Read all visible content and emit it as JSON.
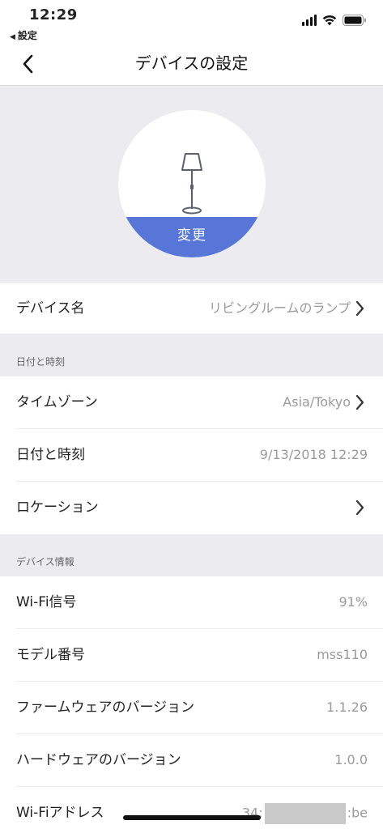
{
  "status_bar": {
    "time": "12:29",
    "back_app": "設定"
  },
  "nav": {
    "title": "デバイスの設定"
  },
  "device_image": {
    "change_label": "変更",
    "accent_color": "#5776d8"
  },
  "device_name_row": {
    "label": "デバイス名",
    "value": "リビングルームのランプ"
  },
  "datetime_section": {
    "header": "日付と時刻",
    "rows": [
      {
        "label": "タイムゾーン",
        "value": "Asia/Tokyo"
      },
      {
        "label": "日付と時刻",
        "value": "9/13/2018 12:29"
      },
      {
        "label": "ロケーション",
        "value": ""
      }
    ]
  },
  "device_info_section": {
    "header": "デバイス情報",
    "rows": [
      {
        "label": "Wi-Fi信号",
        "value": "91%"
      },
      {
        "label": "モデル番号",
        "value": "mss110"
      },
      {
        "label": "ファームウェアのバージョン",
        "value": "1.1.26"
      },
      {
        "label": "ハードウェアのバージョン",
        "value": "1.0.0"
      },
      {
        "label": "Wi-Fiアドレス",
        "value_prefix": "34:",
        "value_suffix": ":be"
      }
    ]
  }
}
